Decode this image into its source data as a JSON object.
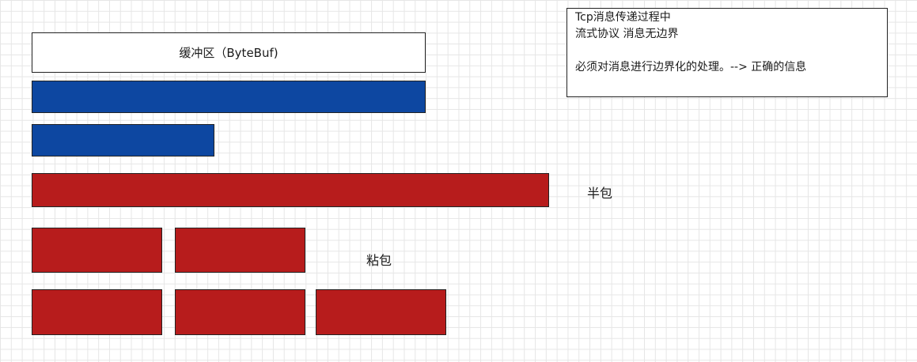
{
  "buffer": {
    "label": "缓冲区（ByteBuf)"
  },
  "labels": {
    "half_packet": "半包",
    "sticky_packet": "粘包"
  },
  "note": {
    "lines": [
      "Tcp消息传递过程中",
      "流式协议 消息无边界",
      "必须对消息进行边界化的处理。--> 正确的信息"
    ]
  },
  "colors": {
    "buffer_fill": "#ffffff",
    "message_blue": "#0d47a1",
    "packet_red": "#b71c1c",
    "grid_line": "#e6e6e6"
  }
}
